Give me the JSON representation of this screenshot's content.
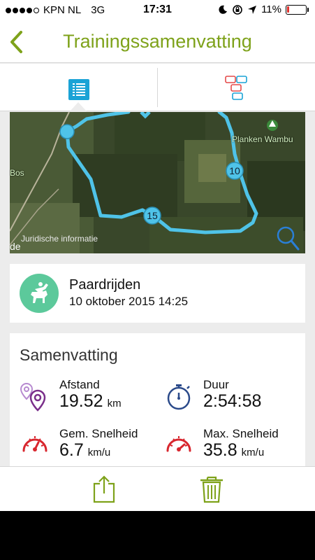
{
  "status_bar": {
    "carrier": "KPN NL",
    "network": "3G",
    "time": "17:31",
    "battery": "11%",
    "battery_level": 0.11,
    "signal_bars": 4,
    "signal_max": 5
  },
  "header": {
    "title": "Trainingssamenvatting",
    "accent_color": "#7ea21a"
  },
  "tabs": [
    {
      "icon": "list-icon",
      "selected": true
    },
    {
      "icon": "chat-bubbles-icon",
      "selected": false
    }
  ],
  "map": {
    "legal_link": "Juridische informatie",
    "place_labels": [
      "Bos",
      "Planken Wambu"
    ],
    "edge_text": "de",
    "markers": [
      "10",
      "15"
    ],
    "route_color": "#4fc3e8"
  },
  "activity": {
    "name": "Paardrijden",
    "date": "10 oktober 2015 14:25",
    "icon": "horse-riding-icon",
    "icon_color": "#5cc99b"
  },
  "summary": {
    "title": "Samenvatting",
    "stats": [
      {
        "label": "Afstand",
        "value": "19.52",
        "unit": "km",
        "icon": "location-pins-icon"
      },
      {
        "label": "Duur",
        "value": "2:54:58",
        "unit": "",
        "icon": "stopwatch-icon"
      },
      {
        "label": "Gem. Snelheid",
        "value": "6.7",
        "unit": "km/u",
        "icon": "speedometer-icon"
      },
      {
        "label": "Max. Snelheid",
        "value": "35.8",
        "unit": "km/u",
        "icon": "speedometer-icon"
      }
    ]
  },
  "toolbar": {
    "share_icon": "share-icon",
    "delete_icon": "trash-icon"
  }
}
